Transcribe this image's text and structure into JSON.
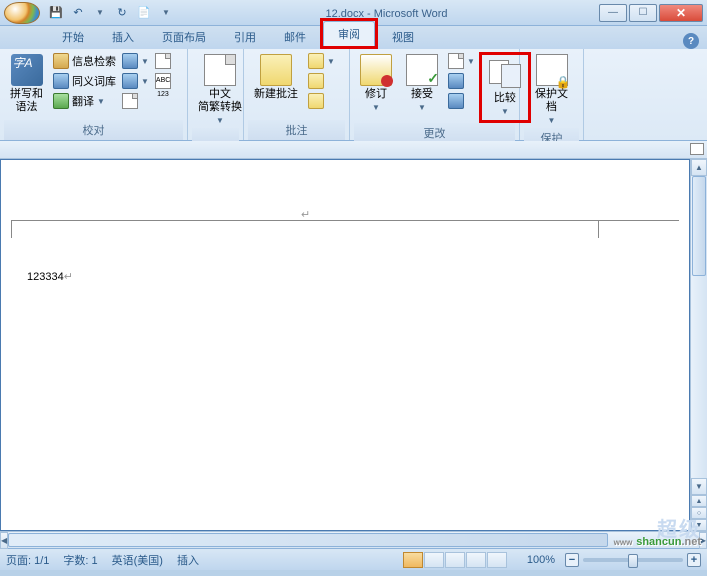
{
  "title": {
    "filename": "12.docx",
    "app": "Microsoft Word",
    "sep": " - "
  },
  "qat": {
    "save": "💾",
    "undo": "↶",
    "repeat": "↻",
    "print": "📄"
  },
  "tabs": {
    "items": [
      "开始",
      "插入",
      "页面布局",
      "引用",
      "邮件",
      "审阅",
      "视图"
    ],
    "active_index": 5
  },
  "ribbon": {
    "proofing": {
      "label": "校对",
      "spelling": "拼写和\n语法",
      "research": "信息检索",
      "thesaurus": "同义词库",
      "translate": "翻译",
      "wordcount_icon": "123"
    },
    "chinese": {
      "convert": "中文\n简繁转换"
    },
    "comments": {
      "label": "批注",
      "new": "新建批注"
    },
    "tracking": {
      "label": "更改",
      "track": "修订",
      "accept": "接受",
      "compare": "比较"
    },
    "protect": {
      "label": "保护",
      "protect": "保护文档"
    }
  },
  "document": {
    "text": "123334",
    "cursor": "↵",
    "para": "↵"
  },
  "status": {
    "page": "页面: 1/1",
    "words": "字数: 1",
    "lang": "英语(美国)",
    "mode": "插入",
    "zoom": "100%"
  },
  "watermark": {
    "bg": "超级",
    "main": "shancun",
    "tld": ".net",
    "sub": "www"
  }
}
